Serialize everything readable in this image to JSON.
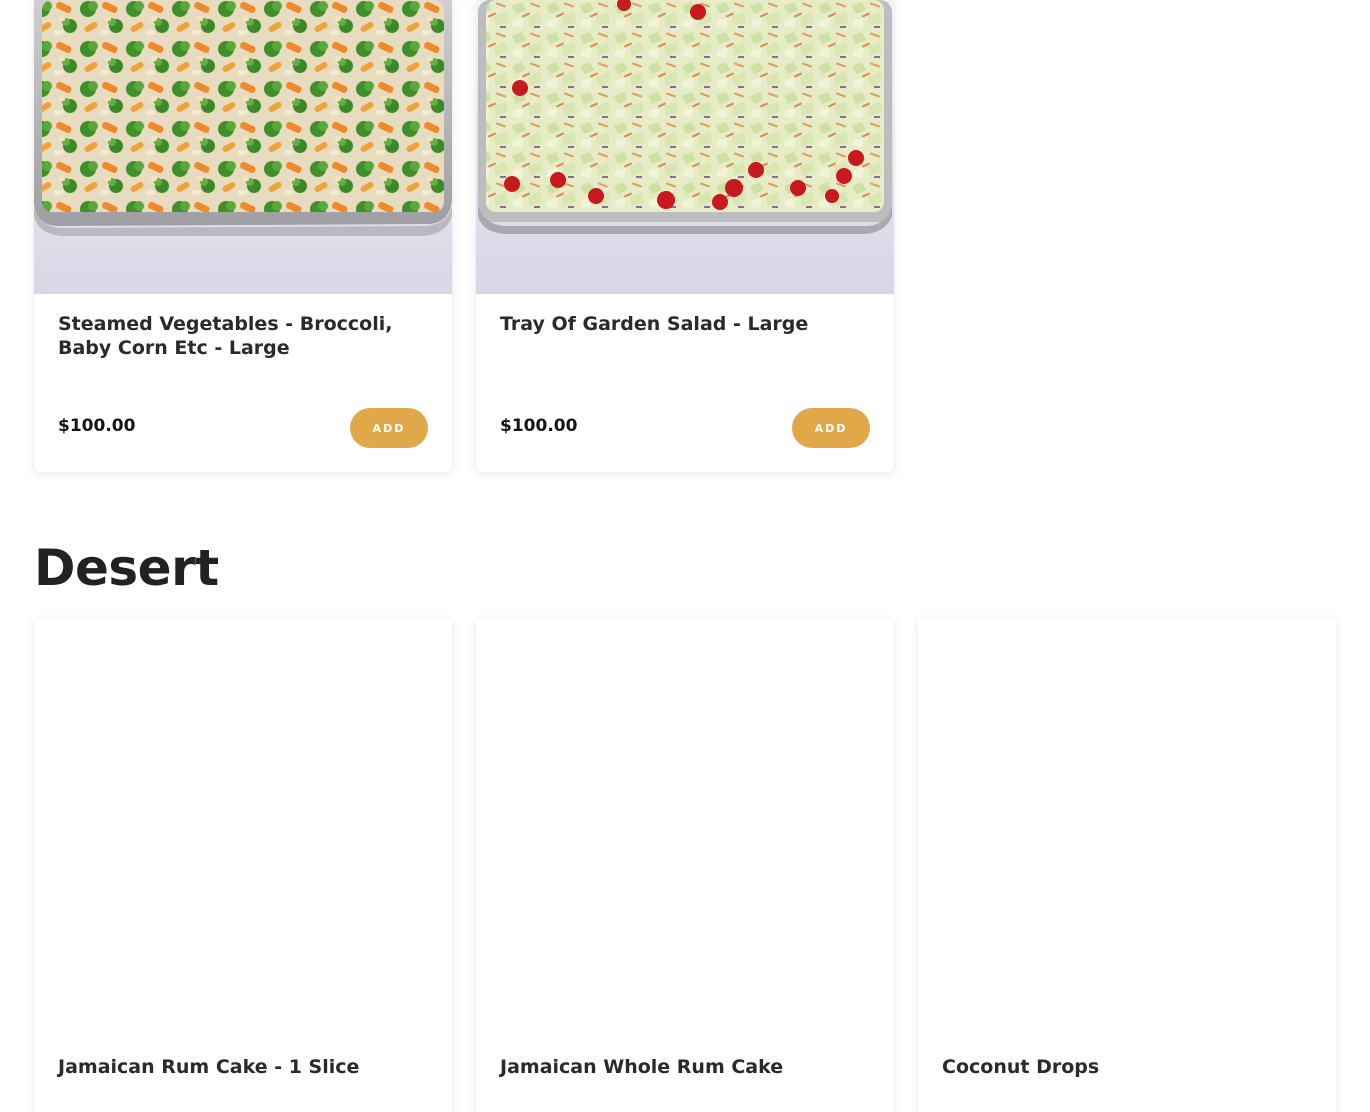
{
  "categories": [
    {
      "items": [
        {
          "name": "Steamed Vegetables - Broccoli, Baby Corn Etc - Large",
          "price": "$100.00",
          "add_label": "ADD",
          "image": "steamed-vegetables-tray-photo"
        },
        {
          "name": "Tray Of Garden Salad - Large",
          "price": "$100.00",
          "add_label": "ADD",
          "image": "garden-salad-tray-photo"
        }
      ]
    },
    {
      "title": "Desert",
      "items": [
        {
          "name": "Jamaican Rum Cake - 1 Slice"
        },
        {
          "name": "Jamaican Whole Rum Cake"
        },
        {
          "name": "Coconut Drops"
        }
      ]
    }
  ],
  "colors": {
    "accent": "#e1a84a",
    "text": "#222222",
    "background": "#ffffff"
  }
}
